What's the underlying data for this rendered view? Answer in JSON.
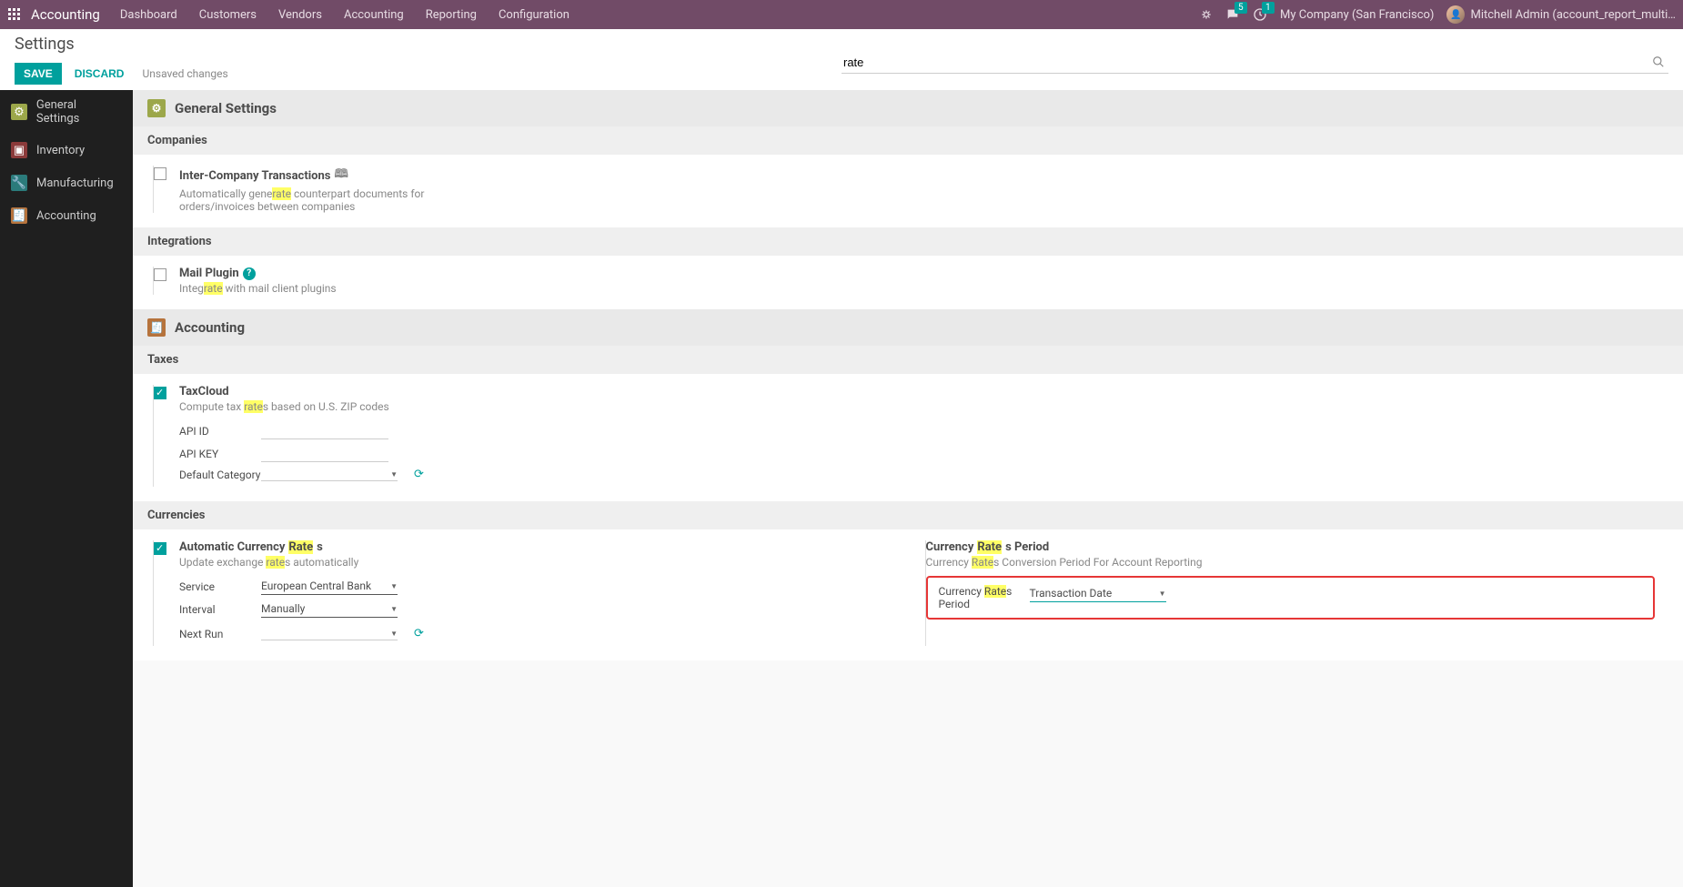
{
  "topbar": {
    "brand": "Accounting",
    "nav": [
      "Dashboard",
      "Customers",
      "Vendors",
      "Accounting",
      "Reporting",
      "Configuration"
    ],
    "badges": {
      "messages": "5",
      "activities": "1"
    },
    "company": "My Company (San Francisco)",
    "user": "Mitchell Admin (account_report_multi…"
  },
  "cp": {
    "title": "Settings",
    "save": "SAVE",
    "discard": "DISCARD",
    "status": "Unsaved changes",
    "search": "rate"
  },
  "sidebar": {
    "items": [
      {
        "label": "General Settings"
      },
      {
        "label": "Inventory"
      },
      {
        "label": "Manufacturing"
      },
      {
        "label": "Accounting"
      }
    ]
  },
  "general": {
    "header": "General Settings",
    "companies_header": "Companies",
    "intercompany": {
      "title": "Inter-Company Transactions",
      "desc1": "Automatically gene",
      "desc_hl": "rate",
      "desc2": " counterpart documents for orders/invoices between companies"
    },
    "integrations_header": "Integrations",
    "mailplugin": {
      "title": "Mail Plugin",
      "desc1": "Integ",
      "desc_hl": "rate",
      "desc2": " with mail client plugins"
    }
  },
  "accounting": {
    "header": "Accounting",
    "taxes_header": "Taxes",
    "taxcloud": {
      "title": "TaxCloud",
      "desc1": "Compute tax ",
      "desc_hl": "rate",
      "desc2": "s based on U.S. ZIP codes",
      "api_id_label": "API ID",
      "api_key_label": "API KEY",
      "default_category_label": "Default Category"
    },
    "currencies_header": "Currencies",
    "autorates": {
      "title1": "Automatic Currency ",
      "title_hl": "Rate",
      "title2": "s",
      "desc1": "Update exchange ",
      "desc_hl": "rate",
      "desc2": "s automatically",
      "service_label": "Service",
      "service_value": "European Central Bank",
      "interval_label": "Interval",
      "interval_value": "Manually",
      "nextrun_label": "Next Run"
    },
    "ratesperiod": {
      "title1": "Currency ",
      "title_hl": "Rate",
      "title2": "s Period",
      "desc1": "Currency ",
      "desc_hl": "Rate",
      "desc2": "s Conversion Period For Account Reporting",
      "field_label1": "Currency ",
      "field_label_hl": "Rate",
      "field_label2": "s Period",
      "field_value": "Transaction Date"
    }
  }
}
